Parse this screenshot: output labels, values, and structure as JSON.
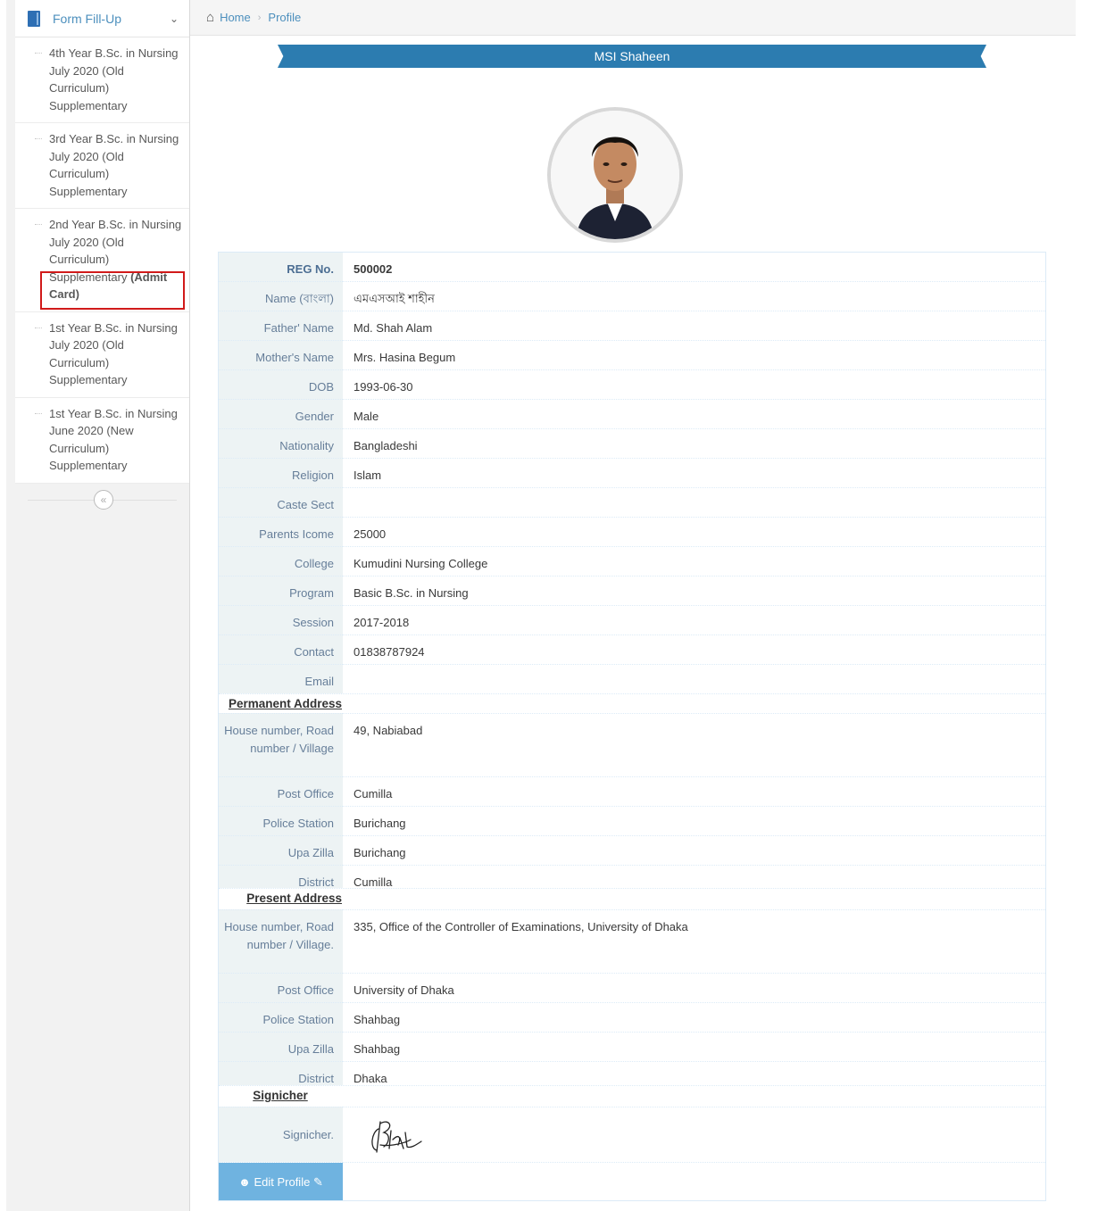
{
  "sidebar": {
    "menu_title": "Form Fill-Up",
    "items": [
      {
        "label": "4th Year B.Sc. in Nursing July 2020 (Old Curriculum) Supplementary",
        "suffix": ""
      },
      {
        "label": "3rd Year B.Sc. in Nursing July 2020 (Old Curriculum) Supplementary",
        "suffix": ""
      },
      {
        "label": "2nd Year B.Sc. in Nursing July 2020 (Old Curriculum) Supplementary",
        "suffix": "(Admit Card)"
      },
      {
        "label": "1st Year B.Sc. in Nursing July 2020 (Old Curriculum) Supplementary",
        "suffix": ""
      },
      {
        "label": "1st Year B.Sc. in Nursing June 2020 (New Curriculum) Supplementary",
        "suffix": ""
      }
    ]
  },
  "breadcrumbs": {
    "home": "Home",
    "current": "Profile"
  },
  "profile": {
    "name_banner": "MSI Shaheen",
    "edit_button": "Edit Profile"
  },
  "fields": [
    {
      "label": "REG No.",
      "value": "500002",
      "bold": true
    },
    {
      "label": "Name (বাংলা)",
      "value": "এমএসআই শাহীন"
    },
    {
      "label": "Father' Name",
      "value": "Md. Shah Alam"
    },
    {
      "label": "Mother's Name",
      "value": "Mrs. Hasina Begum"
    },
    {
      "label": "DOB",
      "value": "1993-06-30"
    },
    {
      "label": "Gender",
      "value": "Male"
    },
    {
      "label": "Nationality",
      "value": "Bangladeshi"
    },
    {
      "label": "Religion",
      "value": "Islam"
    },
    {
      "label": "Caste Sect",
      "value": ""
    },
    {
      "label": "Parents Icome",
      "value": "25000"
    },
    {
      "label": "College",
      "value": "Kumudini Nursing College"
    },
    {
      "label": "Program",
      "value": "Basic B.Sc. in Nursing"
    },
    {
      "label": "Session",
      "value": "2017-2018"
    },
    {
      "label": "Contact",
      "value": "01838787924"
    },
    {
      "label": "Email",
      "value": ""
    }
  ],
  "permanent_address": {
    "heading": "Permanent Address",
    "rows": [
      {
        "label": "House number, Road number / Village",
        "value": "49, Nabiabad"
      },
      {
        "label": "Post Office",
        "value": "Cumilla"
      },
      {
        "label": "Police Station",
        "value": "Burichang"
      },
      {
        "label": "Upa Zilla",
        "value": "Burichang"
      },
      {
        "label": "District",
        "value": "Cumilla"
      }
    ]
  },
  "present_address": {
    "heading": "Present Address",
    "rows": [
      {
        "label": "House number, Road number / Village.",
        "value": "335, Office of the Controller of Examinations, University of Dhaka"
      },
      {
        "label": "Post Office",
        "value": "University of Dhaka"
      },
      {
        "label": "Police Station",
        "value": "Shahbag"
      },
      {
        "label": "Upa Zilla",
        "value": "Shahbag"
      },
      {
        "label": "District",
        "value": "Dhaka"
      }
    ]
  },
  "signature": {
    "heading": "Signicher",
    "label": "Signicher."
  },
  "colors": {
    "accent": "#2c7cb0",
    "link": "#4c8fbd",
    "label_bg": "#edf3f4",
    "highlight": "#d11a1a",
    "button": "#6fb3e0"
  }
}
